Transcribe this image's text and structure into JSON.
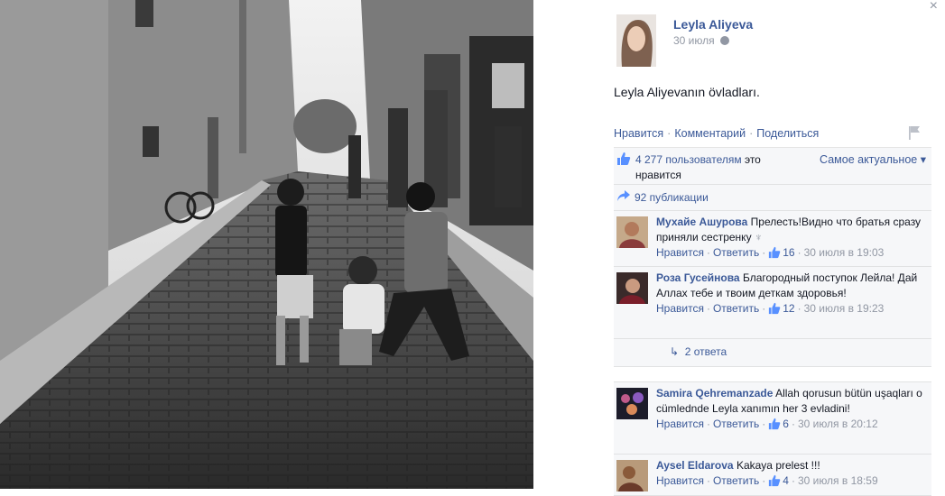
{
  "post": {
    "author": "Leyla Aliyeva",
    "date": "30 июля",
    "text": "Leyla Aliyevanın övladları.",
    "actions": [
      "Нравится",
      "Комментарий",
      "Поделиться"
    ],
    "separator": "·"
  },
  "likes": {
    "count_text": "4 277 пользователям",
    "suffix": "это нравится",
    "sort_label": "Самое актуальное",
    "sort_arrow": "▾"
  },
  "shares": {
    "text": "92 публикации"
  },
  "comment_actions": {
    "like": "Нравится",
    "reply": "Ответить"
  },
  "comments": [
    {
      "name": "Мухайе Ашурова",
      "text": "Прелесть!Видно что братья сразу приняли сестренку",
      "likes": "16",
      "time": "30 июля в 19:03"
    },
    {
      "name": "Роза Гусейнова",
      "text": "Благородный поступок Лейла! Дай Аллах тебе и твоим деткам здоровья!",
      "likes": "12",
      "time": "30 июля в 19:23"
    },
    {
      "name": "Samira Qehremanzade",
      "text": "Allah qorusun bütün uşaqları o cümlednde Leyla xanımın her 3 evladini!",
      "likes": "6",
      "time": "30 июля в 20:12"
    },
    {
      "name": "Aysel Eldarova",
      "text": "Kakaya prelest !!!",
      "likes": "4",
      "time": "30 июля в 18:59"
    }
  ],
  "replies_link": "2 ответа",
  "close": "×",
  "colors": {
    "link": "#3b5998",
    "muted": "#9197a3",
    "box_bg": "#f6f7f9"
  }
}
